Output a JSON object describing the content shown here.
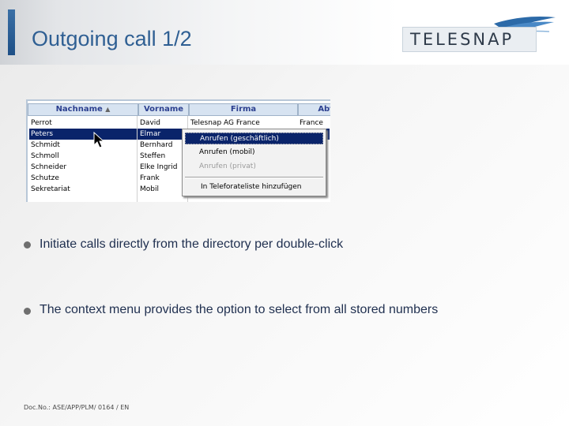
{
  "slide": {
    "title": "Outgoing call 1/2",
    "logo_text": "TELESNAP",
    "bullets": [
      "Initiate calls directly from the directory per double-click",
      "The context menu provides the option to select from all stored numbers"
    ],
    "footer": "Doc.No.: ASE/APP/PLM/ 0164 / EN"
  },
  "directory": {
    "columns": [
      "Nachname",
      "Vorname",
      "Firma",
      "Abt"
    ],
    "rows": [
      [
        "Perrot",
        "David",
        "Telesnap AG France",
        "France"
      ],
      [
        "Peters",
        "Elmar",
        "",
        ""
      ],
      [
        "Schmidt",
        "Bernhard",
        "",
        ""
      ],
      [
        "Schmoll",
        "Steffen",
        "",
        ""
      ],
      [
        "Schneider",
        "Elke Ingrid",
        "",
        ""
      ],
      [
        "Schutze",
        "Frank",
        "",
        ""
      ],
      [
        "Sekretariat",
        "Mobil",
        "",
        ""
      ]
    ],
    "selected_row_index": 1
  },
  "context_menu": {
    "items": [
      {
        "label": "Anrufen (geschäftlich)",
        "state": "highlighted"
      },
      {
        "label": "Anrufen (mobil)",
        "state": "normal"
      },
      {
        "label": "Anrufen (privat)",
        "state": "disabled"
      },
      {
        "label": "In Teleforateliste hinzufügen",
        "state": "normal"
      }
    ]
  },
  "colors": {
    "title": "#2f5f93",
    "selection": "#0a246a",
    "header_bg": "#d7e3f1"
  }
}
